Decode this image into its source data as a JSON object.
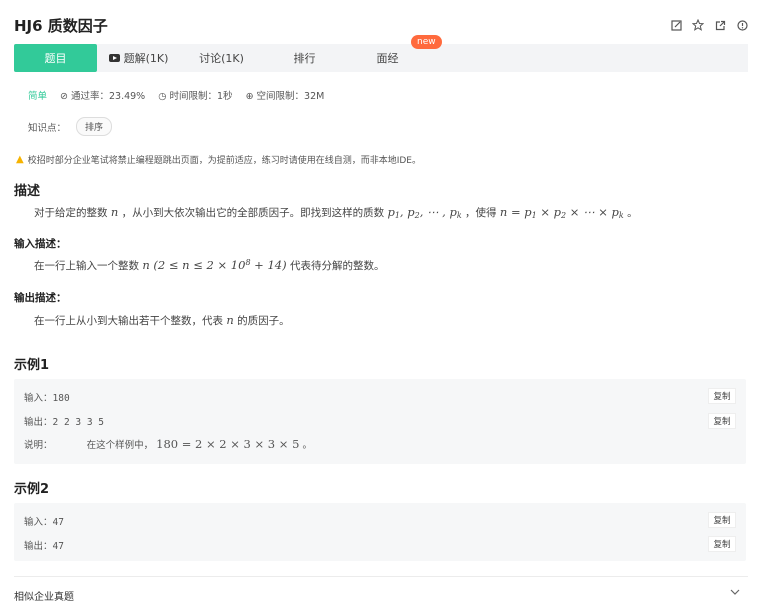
{
  "header": {
    "title": "HJ6  质数因子"
  },
  "tabs": [
    {
      "label": "题目"
    },
    {
      "label": "题解(1K)"
    },
    {
      "label": "讨论(1K)"
    },
    {
      "label": "排行"
    },
    {
      "label": "面经",
      "badge": "new"
    }
  ],
  "meta": {
    "difficulty": "简单",
    "pass_rate": "通过率：23.49%",
    "time_limit": "时间限制：1秒",
    "space_limit": "空间限制：32M"
  },
  "knowledge": {
    "label": "知识点：",
    "tag": "排序"
  },
  "warning": "校招时部分企业笔试将禁止编程题跳出页面，为提前适应，练习时请使用在线自测，而非本地IDE。",
  "description": {
    "heading": "描述",
    "text_prefix": "对于给定的整数",
    "var_n": "n",
    "text_mid": "，从小到大依次输出它的全部质因子。即找到这样的质数",
    "text_mid2": "，使得",
    "text_end": "。"
  },
  "input_desc": {
    "heading": "输入描述：",
    "prefix": "在一行上输入一个整数",
    "suffix": "代表待分解的整数。"
  },
  "output_desc": {
    "heading": "输出描述：",
    "prefix": "在一行上从小到大输出若干个整数，代表",
    "var": "n",
    "suffix": "的质因子。"
  },
  "examples": [
    {
      "heading": "示例1",
      "input_label": "输入：",
      "input": "180",
      "output_label": "输出：",
      "output": "2 2 3 3 5",
      "note_label": "说明：",
      "note_prefix": "在这个样例中，",
      "note_math": "180 = 2 × 2 × 3 × 3 × 5",
      "note_end": "。"
    },
    {
      "heading": "示例2",
      "input_label": "输入：",
      "input": "47",
      "output_label": "输出：",
      "output": "47"
    }
  ],
  "copy_label": "复制",
  "similar": {
    "label": "相似企业真题"
  },
  "colors": {
    "accent": "#32ca99",
    "badge": "#ff6a3d",
    "warning": "#f6b300"
  }
}
